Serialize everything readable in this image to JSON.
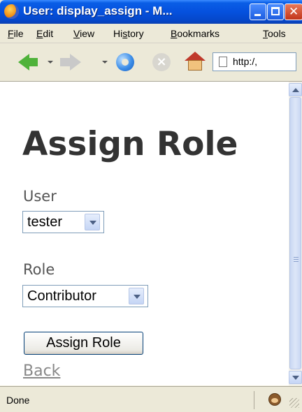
{
  "window": {
    "title": "User: display_assign - M...",
    "controls": {
      "minimize": "minimize",
      "maximize": "maximize",
      "close": "✕"
    }
  },
  "menubar": {
    "items": [
      {
        "key": "F",
        "rest": "ile"
      },
      {
        "key": "E",
        "rest": "dit"
      },
      {
        "key": "V",
        "rest": "iew"
      },
      {
        "pre": "Hi",
        "key": "s",
        "rest": "tory"
      },
      {
        "key": "B",
        "rest": "ookmarks"
      },
      {
        "key": "T",
        "rest": "ools"
      }
    ]
  },
  "toolbar": {
    "url": "http:/,",
    "icons": [
      "back-icon",
      "forward-icon",
      "reload-icon",
      "stop-icon",
      "home-icon",
      "page-icon"
    ]
  },
  "page": {
    "title": "Assign Role",
    "user_label": "User",
    "user_value": "tester",
    "role_label": "Role",
    "role_value": "Contributor",
    "submit_label": "Assign Role",
    "back_link": "Back"
  },
  "status": {
    "text": "Done"
  },
  "colors": {
    "titlebar": "#0551de",
    "heading": "#333333",
    "label": "#555555",
    "link": "#888888"
  }
}
